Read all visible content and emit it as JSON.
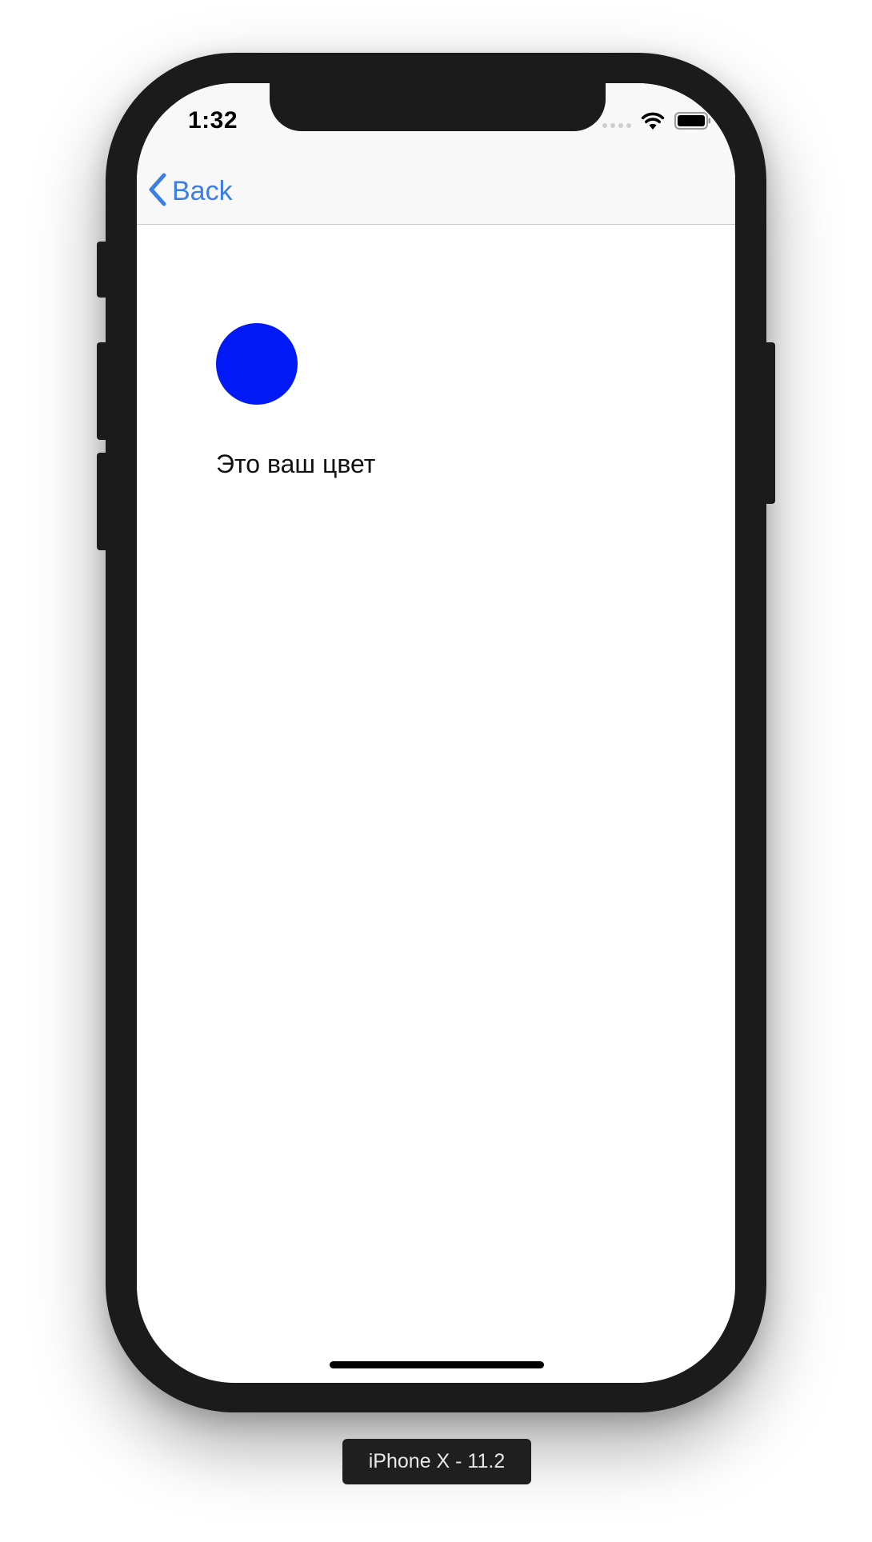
{
  "status_bar": {
    "time": "1:32"
  },
  "nav_bar": {
    "back_label": "Back"
  },
  "content": {
    "color_label": "Это ваш цвет",
    "swatch_color": "#0019f5"
  },
  "simulator": {
    "device_label": "iPhone X - 11.2"
  },
  "colors": {
    "accent": "#3b7ee5",
    "device_frame": "#1b1b1b",
    "nav_background": "#f8f8f8"
  },
  "icons": {
    "back": "chevron-left-icon",
    "signal": "signal-dots-icon",
    "wifi": "wifi-icon",
    "battery": "battery-icon"
  }
}
